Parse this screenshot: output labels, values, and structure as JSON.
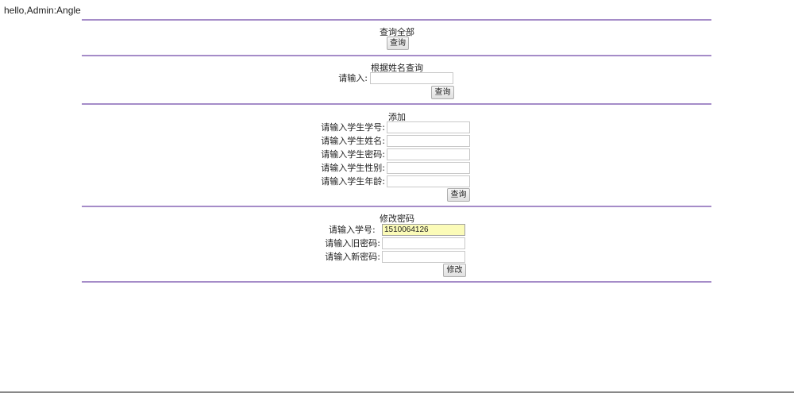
{
  "greeting": "hello,Admin:Angle",
  "query_all": {
    "title": "查询全部",
    "button": "查询"
  },
  "query_by_name": {
    "title": "根据姓名查询",
    "label": "请输入:",
    "value": "",
    "button": "查询"
  },
  "add": {
    "title": "添加",
    "fields": [
      {
        "label": "请输入学生学号:",
        "value": ""
      },
      {
        "label": "请输入学生姓名:",
        "value": ""
      },
      {
        "label": "请输入学生密码:",
        "value": ""
      },
      {
        "label": "请输入学生性别:",
        "value": ""
      },
      {
        "label": "请输入学生年龄:",
        "value": ""
      }
    ],
    "button": "查询"
  },
  "change_password": {
    "title": "修改密码",
    "fields": [
      {
        "label": "请输入学号:",
        "value": "1510064126"
      },
      {
        "label": "请输入旧密码:",
        "value": ""
      },
      {
        "label": "请输入新密码:",
        "value": ""
      }
    ],
    "button": "修改"
  }
}
